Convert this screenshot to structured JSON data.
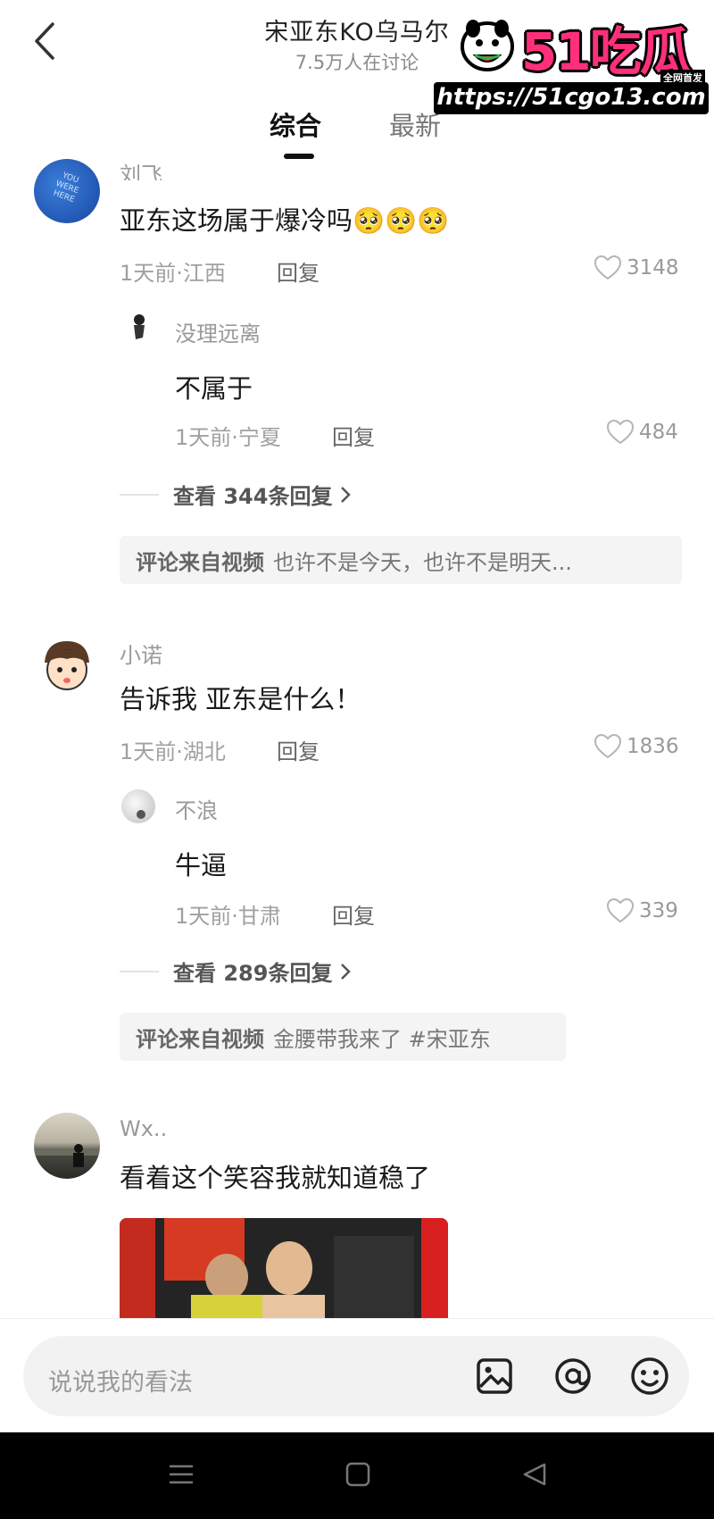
{
  "header": {
    "title": "宋亚东KO乌马尔",
    "subtitle": "7.5万人在讨论",
    "tabs": [
      {
        "label": "综合"
      },
      {
        "label": "最新"
      }
    ]
  },
  "watermark": {
    "brand": "51吃瓜",
    "tag": "全网首发",
    "url": "https://51cgo13.com"
  },
  "comments": [
    {
      "user": "刘飞",
      "avatar_text": "YOU WERE HERE",
      "text": "亚东这场属于爆冷吗",
      "emoji": "🥺🥺🥺",
      "meta": "1天前·江西",
      "reply_label": "回复",
      "likes": "3148",
      "reply": {
        "user": "没理远离",
        "text": "不属于",
        "meta": "1天前·宁夏",
        "reply_label": "回复",
        "likes": "484"
      },
      "more_replies": "查看 344条回复",
      "source_label": "评论来自视频",
      "source_text": "也许不是今天，也许不是明天..."
    },
    {
      "user": "小诺",
      "text": "告诉我 亚东是什么！",
      "meta": "1天前·湖北",
      "reply_label": "回复",
      "likes": "1836",
      "reply": {
        "user": "不浪",
        "text": "牛逼",
        "meta": "1天前·甘肃",
        "reply_label": "回复",
        "likes": "339"
      },
      "more_replies": "查看 289条回复",
      "source_label": "评论来自视频",
      "source_text": "金腰带我来了 #宋亚东"
    },
    {
      "user": "Wx..",
      "text": "看着这个笑容我就知道稳了"
    }
  ],
  "input": {
    "placeholder": "说说我的看法"
  },
  "icons": {
    "image": "image-icon",
    "mention": "at-icon",
    "emoji": "smiley-icon",
    "menu": "menu-icon",
    "home": "home-icon",
    "back": "back-triangle-icon"
  },
  "colors": {
    "brand_pink": "#ff2f7a",
    "text_primary": "#1a1a1a",
    "text_meta": "#a0a0a0"
  }
}
